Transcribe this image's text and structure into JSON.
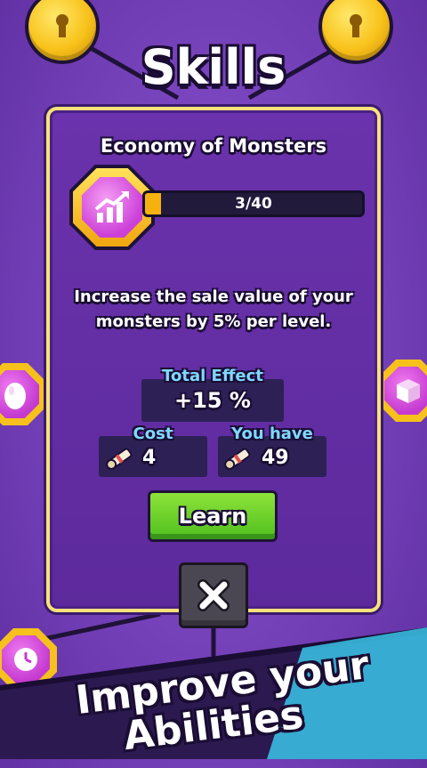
{
  "screen": {
    "title": "Skills"
  },
  "skill": {
    "name": "Economy of Monsters",
    "icon": "chart-up-icon",
    "progress_text": "3/40",
    "progress_fraction": 0.075,
    "description_line1": "Increase the sale value of your",
    "description_line2": "monsters by 5% per level."
  },
  "effect": {
    "label": "Total Effect",
    "value": "+15 %"
  },
  "cost": {
    "label": "Cost",
    "value": "4",
    "icon": "scroll-icon"
  },
  "owned": {
    "label": "You have",
    "value": "49",
    "icon": "scroll-icon"
  },
  "buttons": {
    "learn": "Learn",
    "close_icon": "close-icon"
  },
  "banner": {
    "line1": "Improve your",
    "line2": "Abilities"
  },
  "colors": {
    "accent_gold": "#f6c11d",
    "learn_green": "#4fbf1e",
    "label_blue": "#7fd8ff",
    "banner_cyan": "#39c6e8"
  }
}
